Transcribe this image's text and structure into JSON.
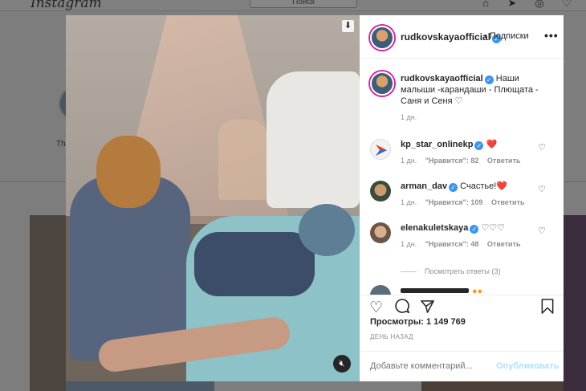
{
  "background": {
    "logo": "Instagram",
    "search_placeholder": "Поиск",
    "story_label": "Th"
  },
  "post": {
    "author": "rudkovskayaofficial",
    "follow_label": "Подписки",
    "more_label": "•••",
    "caption": "Наши малыши -карандаши - Плющата - Саня и Сеня",
    "caption_emoji": "♡",
    "caption_age": "1 дн.",
    "views_text": "Просмотры: 1 149 769",
    "date_text": "ДЕНЬ НАЗАД",
    "comment_placeholder": "Добавьте комментарий...",
    "publish_label": "Опубликовать"
  },
  "comments": [
    {
      "user": "kp_star_onlinekp",
      "text": "❤️",
      "age": "1 дн.",
      "likes": "\"Нравится\": 82",
      "reply": "Ответить",
      "avatar_color": "#f3f3f3"
    },
    {
      "user": "arman_dav",
      "text": "Счастье!❤️",
      "age": "1 дн.",
      "likes": "\"Нравится\": 109",
      "reply": "Ответить",
      "avatar_color": "#3b4a3a"
    },
    {
      "user": "elenakuletskaya",
      "text": "♡♡♡",
      "age": "1 дн.",
      "likes": "\"Нравится\": 48",
      "reply": "Ответить",
      "avatar_color": "#6b5448"
    }
  ],
  "view_replies": "Посмотреть ответы (3)",
  "icons": {
    "like": "heart-icon",
    "comment": "comment-icon",
    "share": "share-icon",
    "save": "bookmark-icon",
    "mute": "muted-speaker-icon"
  }
}
